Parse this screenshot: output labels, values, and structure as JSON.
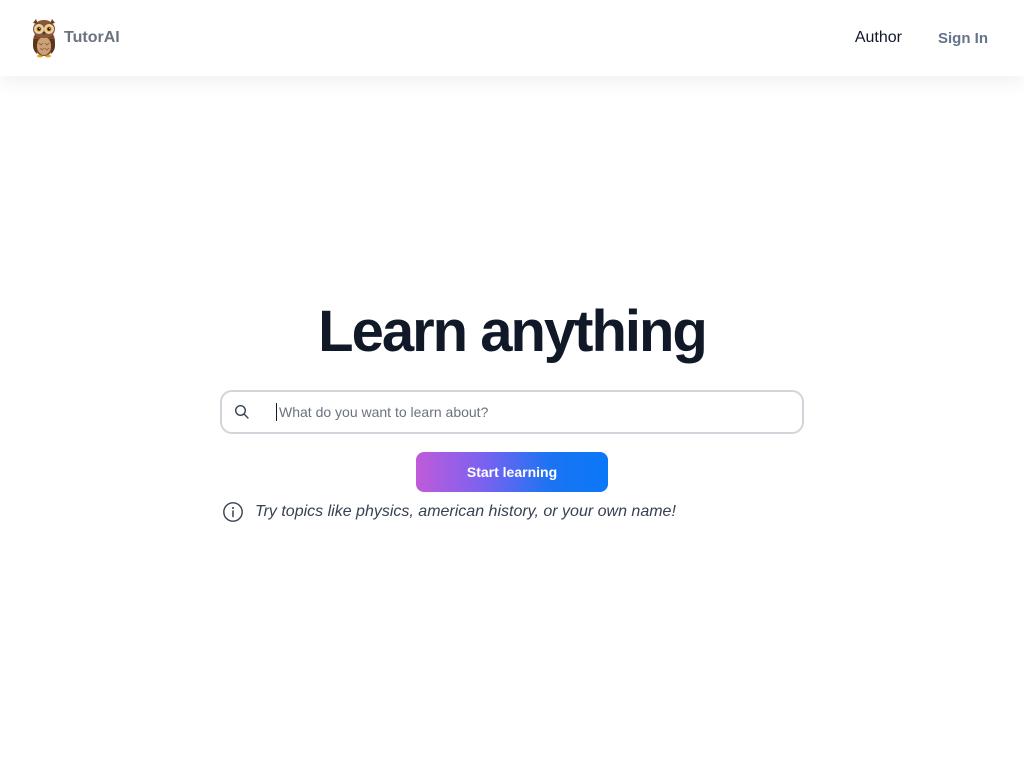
{
  "header": {
    "brand_name": "TutorAI",
    "logo_icon": "owl-icon",
    "nav": {
      "author_label": "Author",
      "signin_label": "Sign In"
    }
  },
  "hero": {
    "headline": "Learn anything",
    "search": {
      "icon": "search-icon",
      "value": "",
      "placeholder": "What do you want to learn about?"
    },
    "cta_label": "Start learning",
    "hint": {
      "icon": "info-icon",
      "text": "Try topics like physics, american history, or your own name!"
    }
  },
  "colors": {
    "headline": "#111827",
    "cta_gradient_start": "#c05bd9",
    "cta_gradient_end": "#0a78f8",
    "brand_text": "#6b7280"
  }
}
